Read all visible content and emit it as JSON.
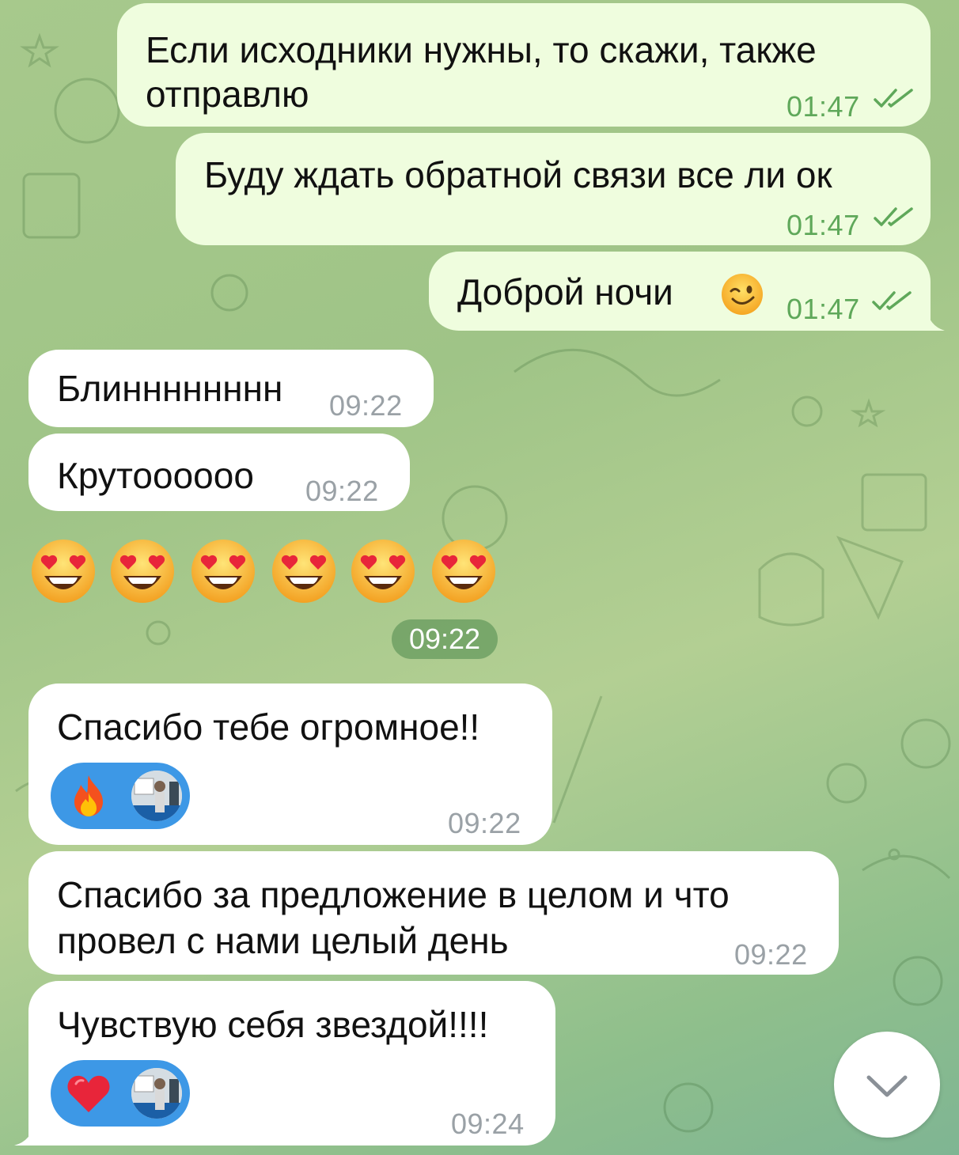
{
  "messages": [
    {
      "direction": "outgoing",
      "text_line1": "Если исходники нужны, то скажи, также",
      "text_line2": "отправлю",
      "time": "01:47",
      "status": "read"
    },
    {
      "direction": "outgoing",
      "text": "Буду ждать обратной связи все ли ок",
      "time": "01:47",
      "status": "read"
    },
    {
      "direction": "outgoing",
      "text": "Доброй ночи",
      "emoji": "winking-face",
      "time": "01:47",
      "status": "read"
    },
    {
      "direction": "incoming",
      "text": "Блинннннннн",
      "time": "09:22"
    },
    {
      "direction": "incoming",
      "text": "Крутоооооо",
      "time": "09:22"
    },
    {
      "direction": "incoming",
      "emoji_only": "smiling-face-with-heart-eyes",
      "count": 6,
      "time": "09:22"
    },
    {
      "direction": "incoming",
      "text": "Спасибо тебе огромное!!",
      "time": "09:22",
      "reaction": {
        "emoji": "fire",
        "color": "#3d98e6"
      }
    },
    {
      "direction": "incoming",
      "text_line1": "Спасибо за предложение в целом и что",
      "text_line2": "провел с нами целый день",
      "time": "09:22"
    },
    {
      "direction": "incoming",
      "text": "Чувствую себя звездой!!!!",
      "time": "09:24",
      "reaction": {
        "emoji": "red-heart",
        "color": "#3d98e6"
      }
    }
  ],
  "colors": {
    "outgoing_bubble": "#effdde",
    "incoming_bubble": "#ffffff",
    "outgoing_time": "#5fa85a",
    "incoming_time": "#9aa1a6",
    "reaction_pill": "#3d98e6"
  },
  "scroll_button_icon": "chevron-down-icon"
}
